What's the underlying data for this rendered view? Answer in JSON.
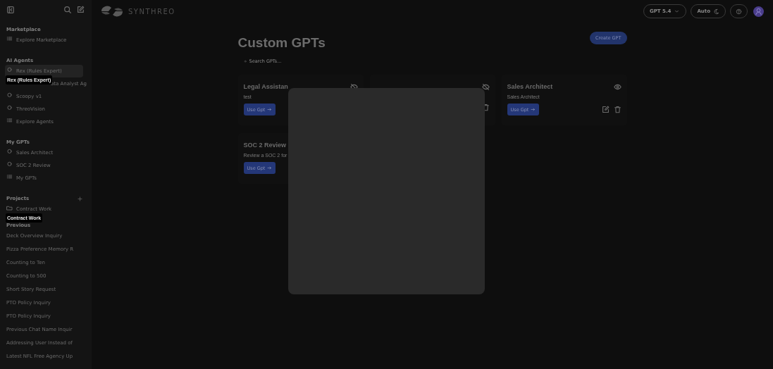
{
  "sidebar": {
    "sections": [
      {
        "label": "Marketplace",
        "items": [
          {
            "label": "Explore Marketplace",
            "kind": "list",
            "selected": false
          }
        ]
      },
      {
        "label": "AI Agents",
        "items": [
          {
            "label": "Rex (Rules Expert)",
            "kind": "circle",
            "selected": true,
            "tooltip": "Rex (Rules Expert)"
          },
          {
            "label": "ata Analyst Ag",
            "kind": "covered",
            "selected": false
          },
          {
            "label": "Scoopy v1",
            "kind": "circle",
            "selected": false
          },
          {
            "label": "ThreoVision",
            "kind": "circle",
            "selected": false
          },
          {
            "label": "Explore Agents",
            "kind": "list",
            "selected": false
          }
        ]
      },
      {
        "label": "My GPTs",
        "items": [
          {
            "label": "Sales Architect",
            "kind": "circle",
            "selected": false
          },
          {
            "label": "SOC 2 Review",
            "kind": "circle",
            "selected": false
          },
          {
            "label": "My GPTs",
            "kind": "list",
            "selected": false
          }
        ]
      },
      {
        "label": "Projects",
        "addable": true,
        "items": [
          {
            "label": "Contract Work",
            "kind": "folder",
            "selected": false,
            "tooltip": "Contract Work"
          }
        ]
      }
    ],
    "history": {
      "label": "Previous",
      "items": [
        "Deck Overview Inquiry",
        "Pizza Preference Memory R",
        "Counting to Ten",
        "Counting to 500",
        "Short Story Request",
        "PTO Policy Inquiry",
        "PTO Policy Inquiry",
        "Previous Chat Name Inquir",
        "Addressing User Instead of",
        "Latest NFL Free Agency Up"
      ]
    }
  },
  "header": {
    "logo": "SYNTHREO",
    "model": "GPT 5.4",
    "theme": "Auto"
  },
  "main": {
    "title": "Custom GPTs",
    "create_button": "Create GPT",
    "search": {
      "placeholder": "Search GPTs..."
    },
    "cards": [
      {
        "title": "Legal Assistan",
        "description": "test",
        "button": "Use Gpt",
        "hidden": true
      },
      {
        "hidden": true,
        "deletable": true
      },
      {
        "title": "Sales Architect",
        "description": "Sales Architect",
        "button": "Use Gpt",
        "hidden": false,
        "editable": true,
        "deletable": true
      },
      {
        "title": "SOC 2 Review",
        "description": "Review a SOC 2 for",
        "button": "Use Gpt"
      }
    ]
  },
  "dialog": {
    "kind": "blank"
  }
}
